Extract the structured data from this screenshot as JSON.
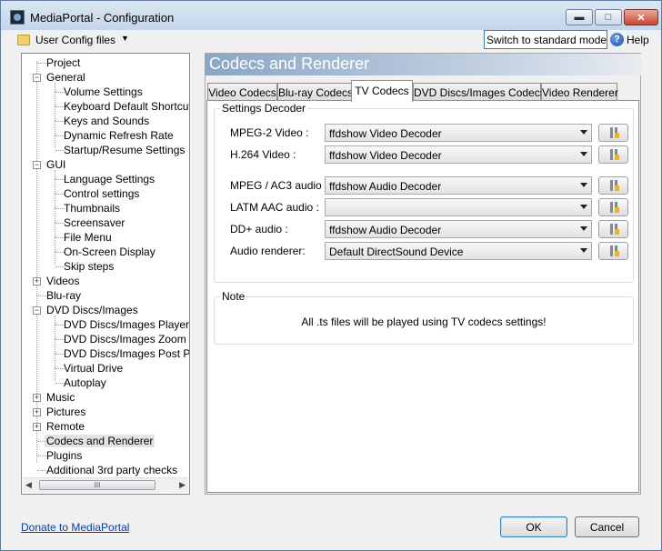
{
  "window": {
    "title": "MediaPortal - Configuration"
  },
  "toolbar": {
    "user_config_label": "User Config files",
    "switch_mode_label": "Switch to standard mode",
    "help_label": "Help"
  },
  "tree": {
    "items": [
      {
        "label": "Project"
      },
      {
        "label": "General"
      },
      {
        "label": "Volume Settings"
      },
      {
        "label": "Keyboard Default Shortcuts"
      },
      {
        "label": "Keys and Sounds"
      },
      {
        "label": "Dynamic Refresh Rate"
      },
      {
        "label": "Startup/Resume Settings"
      },
      {
        "label": "GUI"
      },
      {
        "label": "Language Settings"
      },
      {
        "label": "Control settings"
      },
      {
        "label": "Thumbnails"
      },
      {
        "label": "Screensaver"
      },
      {
        "label": "File Menu"
      },
      {
        "label": "On-Screen Display"
      },
      {
        "label": "Skip steps"
      },
      {
        "label": "Videos"
      },
      {
        "label": "Blu-ray"
      },
      {
        "label": "DVD Discs/Images"
      },
      {
        "label": "DVD Discs/Images Player"
      },
      {
        "label": "DVD Discs/Images Zoom"
      },
      {
        "label": "DVD Discs/Images Post Processing"
      },
      {
        "label": "Virtual Drive"
      },
      {
        "label": "Autoplay"
      },
      {
        "label": "Music"
      },
      {
        "label": "Pictures"
      },
      {
        "label": "Remote"
      },
      {
        "label": "Codecs and Renderer"
      },
      {
        "label": "Plugins"
      },
      {
        "label": "Additional 3rd party checks"
      }
    ],
    "selected": "Codecs and Renderer",
    "scroll_thumb": "III"
  },
  "header": {
    "title": "Codecs and Renderer"
  },
  "tabs": [
    {
      "label": "Video Codecs"
    },
    {
      "label": "Blu-ray Codecs"
    },
    {
      "label": "TV Codecs"
    },
    {
      "label": "DVD Discs/Images Codecs"
    },
    {
      "label": "Video Renderer"
    }
  ],
  "active_tab": "TV Codecs",
  "settings_decoder": {
    "title": "Settings Decoder",
    "rows": [
      {
        "label": "MPEG-2 Video :",
        "value": "ffdshow Video Decoder"
      },
      {
        "label": "H.264 Video :",
        "value": "ffdshow Video Decoder"
      },
      {
        "label": "MPEG / AC3 audio :",
        "value": "ffdshow Audio Decoder"
      },
      {
        "label": "LATM AAC audio :",
        "value": ""
      },
      {
        "label": "DD+ audio :",
        "value": "ffdshow Audio Decoder"
      },
      {
        "label": "Audio renderer:",
        "value": "Default DirectSound Device"
      }
    ]
  },
  "note": {
    "title": "Note",
    "text": "All .ts files will be played using TV codecs settings!"
  },
  "footer": {
    "donate_link": "Donate to MediaPortal",
    "ok_label": "OK",
    "cancel_label": "Cancel"
  }
}
